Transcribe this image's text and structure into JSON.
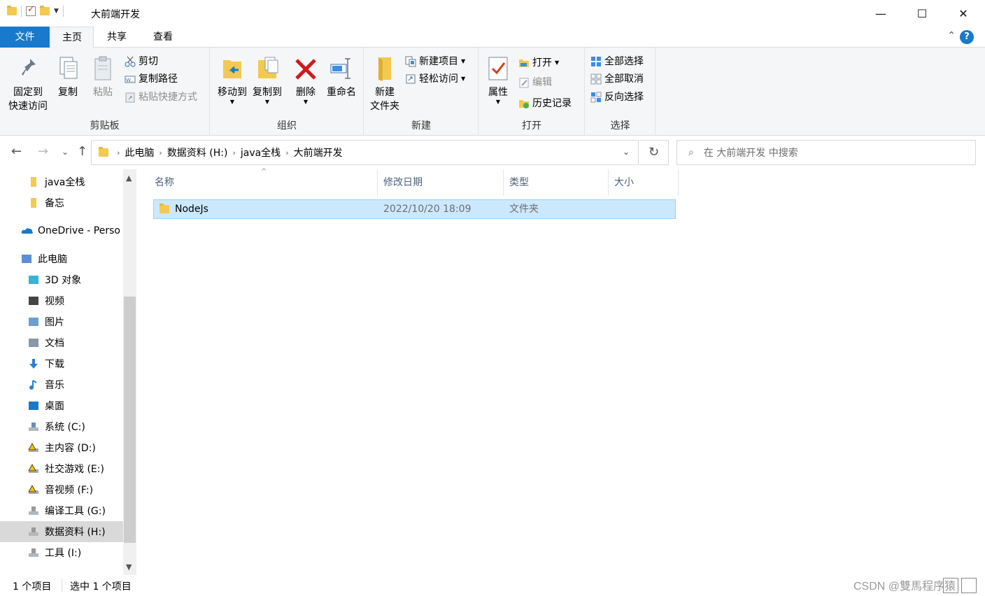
{
  "window": {
    "title": "大前端开发",
    "minimize_glyph": "—",
    "maximize_glyph": "☐",
    "close_glyph": "✕"
  },
  "tabs": {
    "file": "文件",
    "home": "主页",
    "share": "共享",
    "view": "查看",
    "help": "?"
  },
  "ribbon": {
    "clipboard": {
      "label": "剪贴板",
      "pin_line1": "固定到",
      "pin_line2": "快速访问",
      "copy": "复制",
      "paste": "粘贴",
      "cut": "剪切",
      "copy_path": "复制路径",
      "paste_shortcut": "粘贴快捷方式"
    },
    "organize": {
      "label": "组织",
      "move_to": "移动到",
      "copy_to": "复制到",
      "delete": "删除",
      "rename": "重命名"
    },
    "new": {
      "label": "新建",
      "new_folder_line1": "新建",
      "new_folder_line2": "文件夹",
      "new_item": "新建项目",
      "easy_access": "轻松访问"
    },
    "open": {
      "label": "打开",
      "properties": "属性",
      "open": "打开",
      "edit": "编辑",
      "history": "历史记录"
    },
    "select": {
      "label": "选择",
      "select_all": "全部选择",
      "select_none": "全部取消",
      "invert": "反向选择"
    }
  },
  "address": {
    "crumbs": [
      "此电脑",
      "数据资料 (H:)",
      "java全栈",
      "大前端开发"
    ]
  },
  "search": {
    "placeholder": "在 大前端开发 中搜索"
  },
  "nav": {
    "items": [
      {
        "label": "java全栈",
        "icon": "folder-icon"
      },
      {
        "label": "备忘",
        "icon": "folder-icon"
      },
      {
        "label": "OneDrive - Perso",
        "icon": "onedrive-icon"
      },
      {
        "label": "此电脑",
        "icon": "computer-icon"
      },
      {
        "label": "3D 对象",
        "icon": "3d-objects-icon"
      },
      {
        "label": "视频",
        "icon": "video-icon"
      },
      {
        "label": "图片",
        "icon": "pictures-icon"
      },
      {
        "label": "文档",
        "icon": "documents-icon"
      },
      {
        "label": "下载",
        "icon": "download-icon"
      },
      {
        "label": "音乐",
        "icon": "music-icon"
      },
      {
        "label": "桌面",
        "icon": "desktop-icon"
      },
      {
        "label": "系统 (C:)",
        "icon": "system-drive-icon"
      },
      {
        "label": "主内容 (D:)",
        "icon": "drive-warning-icon"
      },
      {
        "label": "社交游戏 (E:)",
        "icon": "drive-warning-icon"
      },
      {
        "label": "音视频 (F:)",
        "icon": "drive-warning-icon"
      },
      {
        "label": "编译工具 (G:)",
        "icon": "drive-icon"
      },
      {
        "label": "数据资料 (H:)",
        "icon": "drive-icon"
      },
      {
        "label": "工具 (I:)",
        "icon": "drive-icon"
      }
    ]
  },
  "columns": {
    "name": "名称",
    "modified": "修改日期",
    "type": "类型",
    "size": "大小"
  },
  "files": [
    {
      "name": "NodeJs",
      "modified": "2022/10/20 18:09",
      "type": "文件夹",
      "size": ""
    }
  ],
  "status": {
    "count": "1 个项目",
    "selected": "选中 1 个项目"
  },
  "watermark": "CSDN @雙馬程序猿",
  "colors": {
    "accent": "#1979ca",
    "selection": "#cce8ff",
    "folder": "#f3c94f"
  }
}
